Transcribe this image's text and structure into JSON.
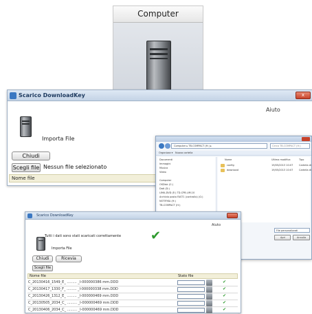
{
  "computer_card": {
    "title": "Computer"
  },
  "window1": {
    "title": "Scarico DownloadKey",
    "menu_help": "Aiuto",
    "import_label": "Importa File",
    "close_button": "Chiudi",
    "choose_file_button": "Scegli file",
    "no_file_text": "Nessun file selezionato",
    "column_name": "Nome file",
    "close_x": "x"
  },
  "window2": {
    "breadcrumb": "Computer ▸ TB-COMPACT (H:) ▸",
    "search_placeholder": "Cerca TB-COMPACT (H:)",
    "toolbar_organize": "Organizza ▾",
    "toolbar_newfolder": "Nuova cartella",
    "nav_items": [
      "Documenti",
      "Immagini",
      "Musica",
      "Video",
      "",
      "Computer",
      "OSDisk (C:)",
      "Dati (D:)",
      "LIMA-DVD (E:) TD-CP8.LIM.10",
      "Archivio posta FAST1 (controllo) (G:)",
      "NOTIFIKA (H:)",
      "TB-COMPACT (H:)"
    ],
    "col_name": "Nome",
    "col_date": "Ultima modifica",
    "col_type": "Tipo",
    "files": [
      {
        "name": "config",
        "date": "19/05/2013 10:07",
        "type": "Cartella di"
      },
      {
        "name": "download",
        "date": "19/05/2013 10:07",
        "type": "Cartella di"
      }
    ],
    "filter": "File personalizzati",
    "open_button": "Apri",
    "cancel_button": "Annulla"
  },
  "window3": {
    "title": "Scarico DownloadKey",
    "menu_help": "Aiuto",
    "success_message": "Tutti i dati sono stati scaricati correttamente",
    "import_label": "Importa File",
    "close_button": "Chiudi",
    "reset_button": "Ricevia",
    "choose_file_button": "Scegli file",
    "column_name": "Nome file",
    "column_state": "Stato file",
    "rows": [
      "C_20130416_1549_E_ ......... _I-000000386 mm.DDD",
      "C_20130417_1330_F_ ......... _I-000000338 mm.DDD",
      "C_20130426_1312_E_ ......... _I-000000469 mm.DDD",
      "C_20130505_2034_C_ ......... _I-000000469 mm.DDD",
      "C_20130406_2034_C_ ......... _I-000000469 mm.DDD"
    ],
    "row_status": "✔",
    "checkmark": "✔"
  },
  "colors": {
    "accent": "#3b78c2",
    "success": "#2e9a2e",
    "close": "#c7432b"
  }
}
